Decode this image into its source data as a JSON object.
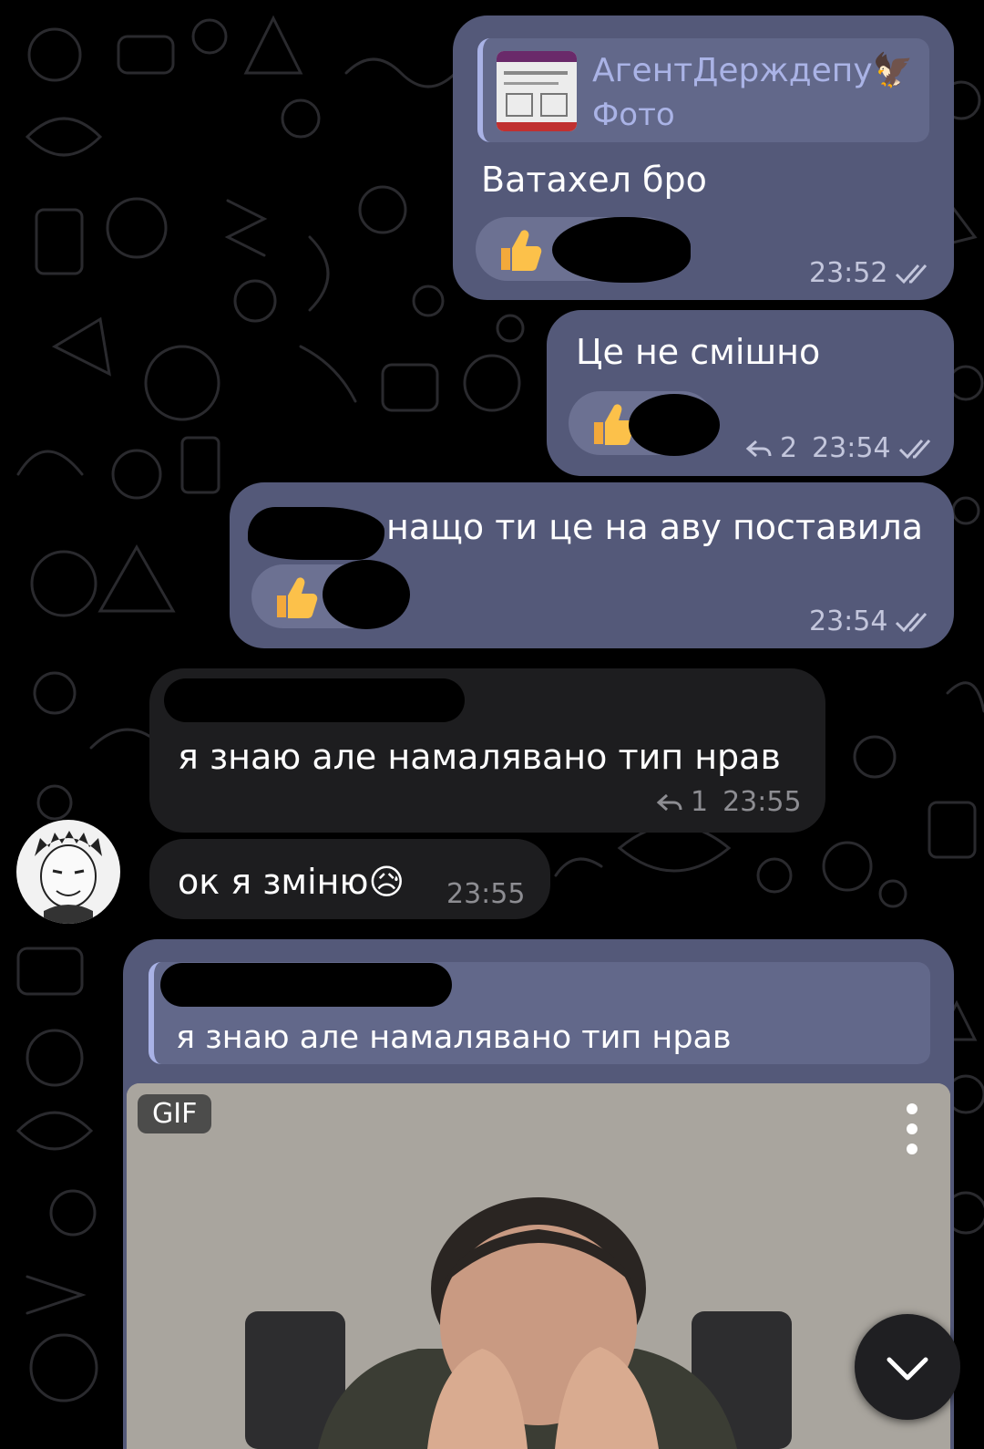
{
  "theme": {
    "outgoing_bubble": "#545979",
    "incoming_bubble": "#1d1d1f",
    "background": "#000000",
    "reaction_pill": "#6c7192",
    "reply_accent": "#a9b2e6"
  },
  "messages": [
    {
      "direction": "outgoing",
      "forward": {
        "author": "АгентДерждепу🦅",
        "media_label": "Фото"
      },
      "text": "Ватахел бро",
      "reaction": "👍",
      "time": "23:52",
      "status": "read"
    },
    {
      "direction": "outgoing",
      "text": "Це не смішно",
      "reaction": "👍",
      "replies": "2",
      "time": "23:54",
      "status": "read"
    },
    {
      "direction": "outgoing",
      "text": "нащо ти це на аву поставила",
      "reaction": "👍",
      "time": "23:54",
      "status": "read"
    },
    {
      "direction": "incoming",
      "text": "я знаю але намалявано тип нрав",
      "replies": "1",
      "time": "23:55"
    },
    {
      "direction": "incoming",
      "text": "ок я зміню😥",
      "time": "23:55"
    },
    {
      "direction": "outgoing",
      "quote": "я знаю але намалявано тип нрав",
      "media": {
        "badge": "GIF",
        "menu_icon": "more-vertical-icon"
      }
    }
  ],
  "icons": {
    "read_ticks": "double-check-icon",
    "reply_count": "reply-arrow-icon",
    "scroll_down": "chevron-down-icon",
    "reaction": "thumbs-up-icon"
  }
}
